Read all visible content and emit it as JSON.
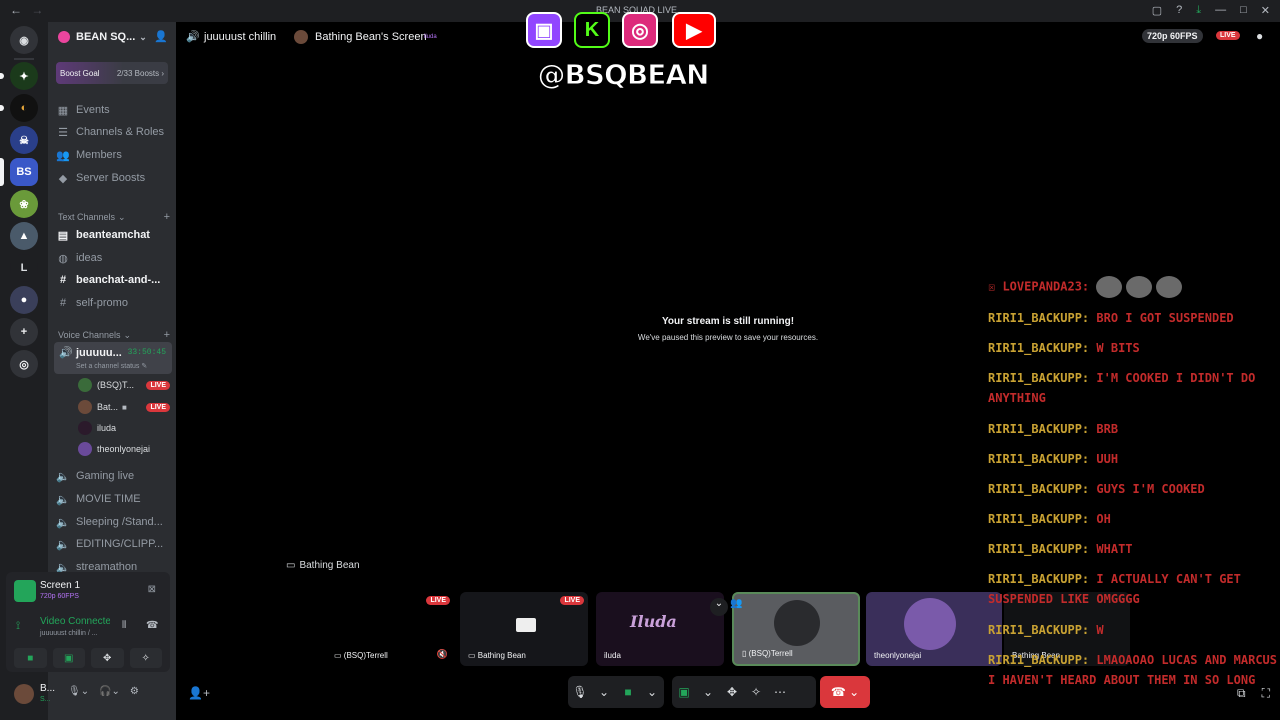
{
  "window": {
    "title": "BEAN SQUAD LIVE",
    "nav_back": "←",
    "nav_forward": "→",
    "icons": [
      "screen-icon",
      "help-icon",
      "download-icon",
      "minimize-icon",
      "maximize-icon",
      "close-icon"
    ]
  },
  "rail": {
    "servers": [
      "discord-home",
      "server-1",
      "server-2",
      "server-3",
      "server-4",
      "server-5",
      "server-6",
      "L",
      "server-8",
      "add-server",
      "discover"
    ],
    "letter_server": "L"
  },
  "guild": {
    "name": "BEAN SQ...",
    "boost_label": "Boost Goal",
    "boost_count": "2/33 Boosts ›",
    "nav": [
      {
        "icon": "calendar-icon",
        "label": "Events"
      },
      {
        "icon": "channels-icon",
        "label": "Channels & Roles"
      },
      {
        "icon": "members-icon",
        "label": "Members"
      },
      {
        "icon": "boost-icon",
        "label": "Server Boosts"
      }
    ],
    "text_category": "Text Channels",
    "text_channels": [
      {
        "label": "beanteamchat",
        "bright": true,
        "unread": true
      },
      {
        "label": "ideas",
        "bright": false,
        "unread": false
      },
      {
        "label": "beanchat-and-...",
        "bright": true,
        "unread": true
      },
      {
        "label": "self-promo",
        "bright": false,
        "unread": false
      }
    ],
    "voice_category": "Voice Channels",
    "active_voice": {
      "name": "juuuuu...",
      "time": "33:50:45",
      "status": "Set a channel status ✎"
    },
    "members": [
      {
        "name": "(BSQ)T...",
        "live": "LIVE",
        "color": "#3a6b3a"
      },
      {
        "name": "Bat...",
        "live": "LIVE",
        "color": "#6b4a3a"
      },
      {
        "name": "iluda",
        "live": "",
        "color": "#2b1a2b"
      },
      {
        "name": "theonlyonejai",
        "live": "",
        "color": "#6a4a9a"
      }
    ],
    "voice_channels": [
      "Gaming live",
      "MOVIE TIME",
      "Sleeping /Stand...",
      "EDITING/CLIPP...",
      "streamathon"
    ]
  },
  "rtc": {
    "screen_title": "Screen 1",
    "screen_quality": "720p 60FPS",
    "connected": "Video Connected",
    "channel_path": "juuuuust chillin / ...",
    "user_name": "B...",
    "user_status": "S..."
  },
  "stage": {
    "channel": "juuuuust chillin",
    "screen_name": "Bathing Bean's Screen",
    "screen_tag": "iluda",
    "quality": "720p 60FPS",
    "live": "LIVE",
    "paused_title": "Your stream is still running!",
    "paused_desc": "We've paused this preview to save your resources.",
    "streamer_label": "Bathing Bean"
  },
  "social": {
    "handle": "@BSQBEAN",
    "platforms": [
      {
        "icon": "twitch-icon",
        "glyph": "▣",
        "color": "#9146ff"
      },
      {
        "icon": "kick-icon",
        "glyph": "K",
        "color": "#53fc18"
      },
      {
        "icon": "instagram-icon",
        "glyph": "◎",
        "color": "#dd2a7b"
      },
      {
        "icon": "youtube-icon",
        "glyph": "▶",
        "color": "#ff0000"
      }
    ]
  },
  "tiles": [
    {
      "name": "(BSQ)Terrell",
      "live": "LIVE",
      "bg": "#000000"
    },
    {
      "name": "Bathing Bean",
      "live": "LIVE",
      "bg": "#15161a"
    },
    {
      "name": "iluda",
      "live": "",
      "bg": "#1a0f1e"
    },
    {
      "name": "(BSQ)Terrell",
      "live": "",
      "bg": "#5a5c60"
    },
    {
      "name": "theonlyonejai",
      "live": "",
      "bg": "#3a2f5a"
    },
    {
      "name": "Bathing Bean",
      "live": "",
      "bg": "#111214"
    }
  ],
  "chat": [
    {
      "user": "LOVEPANDA23:",
      "msg": "",
      "emotes": 3
    },
    {
      "user": "RIRI1_BACKUPP:",
      "msg": "BRO I GOT SUSPENDED"
    },
    {
      "user": "RIRI1_BACKUPP:",
      "msg": "W BITS"
    },
    {
      "user": "RIRI1_BACKUPP:",
      "msg": "I'M COOKED I DIDN'T DO ANYTHING"
    },
    {
      "user": "RIRI1_BACKUPP:",
      "msg": "BRB"
    },
    {
      "user": "RIRI1_BACKUPP:",
      "msg": "UUH"
    },
    {
      "user": "RIRI1_BACKUPP:",
      "msg": "GUYS I'M COOKED"
    },
    {
      "user": "RIRI1_BACKUPP:",
      "msg": "OH"
    },
    {
      "user": "RIRI1_BACKUPP:",
      "msg": "WHATT"
    },
    {
      "user": "RIRI1_BACKUPP:",
      "msg": "I ACTUALLY CAN'T GET SUSPENDED LIKE OMGGGG"
    },
    {
      "user": "RIRI1_BACKUPP:",
      "msg": "W"
    },
    {
      "user": "RIRI1_BACKUPP:",
      "msg": "LMAOAOAO LUCAS AND MARCUS I HAVEN'T HEARD ABOUT THEM IN SO LONG"
    }
  ]
}
